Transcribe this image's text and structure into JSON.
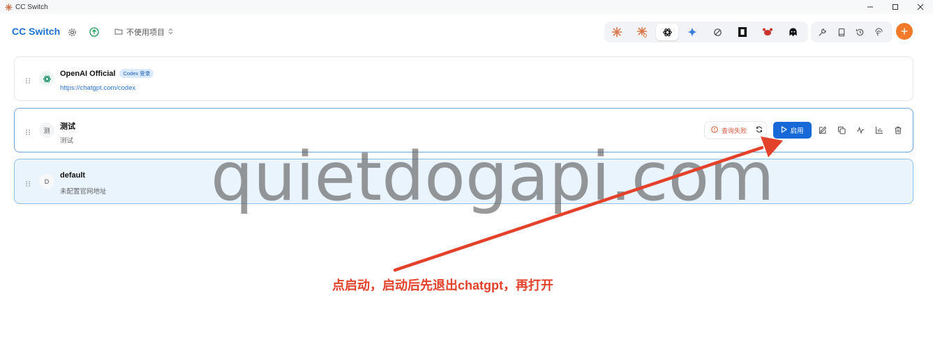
{
  "window": {
    "title": "CC Switch",
    "controls": [
      "minimize-icon",
      "maximize-icon",
      "close-icon"
    ]
  },
  "header": {
    "brand": "CC Switch",
    "project_label": "不使用项目",
    "tools_primary": [
      "claude-icon",
      "claude-alt-icon",
      "openai-icon",
      "gemini-icon",
      "opencode-icon",
      "kimi-icon",
      "crab-icon",
      "qwen-icon"
    ],
    "tools_secondary": [
      "wrench-icon",
      "book-icon",
      "history-icon",
      "fingerprint-icon"
    ],
    "add_button": "+"
  },
  "providers": [
    {
      "avatar": "",
      "name": "OpenAI Official",
      "badge": "Codex 登录",
      "subtitle": "https://chatgpt.com/codex"
    },
    {
      "avatar": "测",
      "name": "测试",
      "subtitle": "测试",
      "status": "查询失败",
      "enable_label": "启用"
    },
    {
      "avatar": "D",
      "name": "default",
      "subtitle": "未配置官网地址"
    }
  ],
  "overlay": {
    "watermark": "quietdogapi.com",
    "annotation": "点启动，启动后先退出chatgpt，再打开"
  },
  "colors": {
    "accent": "#1769d8",
    "brand": "#1d72d6",
    "add": "#f27a2a",
    "error": "#e0583d",
    "annotation": "#e4412a"
  }
}
